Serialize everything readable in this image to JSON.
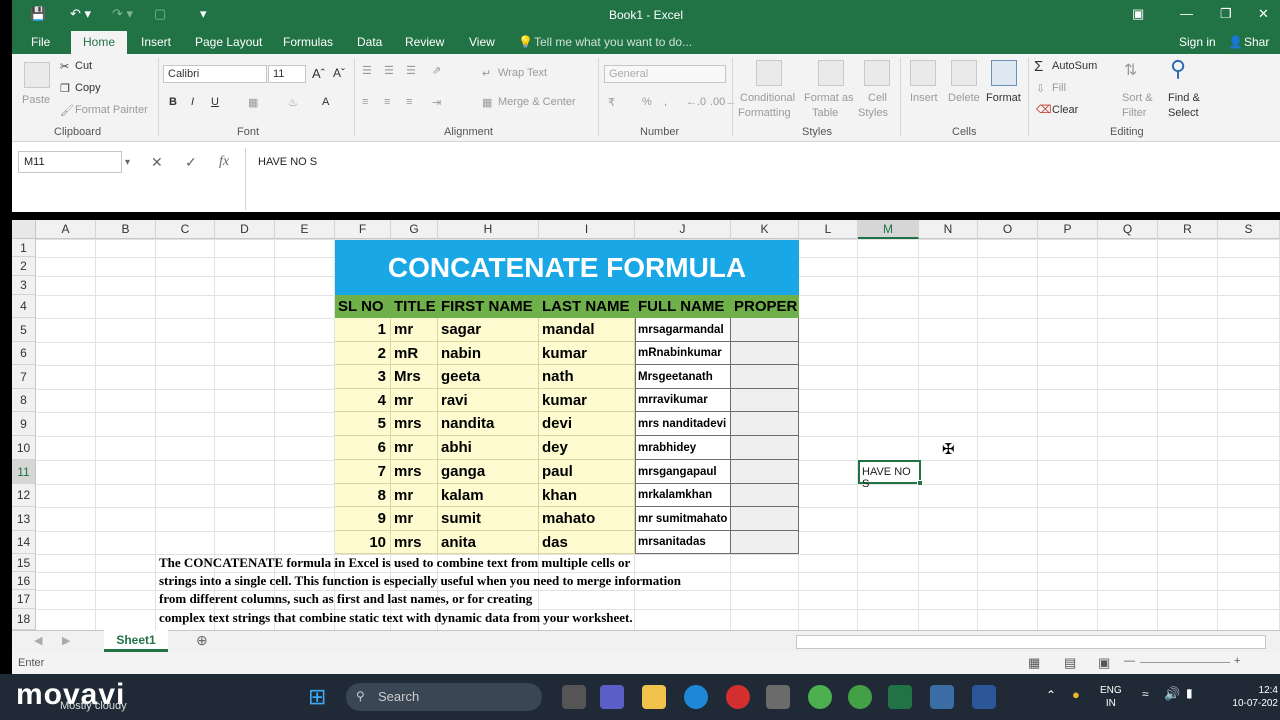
{
  "titlebar": {
    "title": "Book1 - Excel"
  },
  "menu": {
    "file": "File",
    "home": "Home",
    "insert": "Insert",
    "page_layout": "Page Layout",
    "formulas": "Formulas",
    "data": "Data",
    "review": "Review",
    "view": "View",
    "tell_me": "Tell me what you want to do...",
    "sign_in": "Sign in",
    "share": "Shar"
  },
  "ribbon": {
    "paste": "Paste",
    "cut": "Cut",
    "copy": "Copy",
    "format_painter": "Format Painter",
    "font_name": "Calibri",
    "font_size": "11",
    "bold": "B",
    "italic": "I",
    "underline": "U",
    "wrap_text": "Wrap Text",
    "merge_center": "Merge & Center",
    "number_format": "General",
    "percent": "%",
    "conditional_formatting_1": "Conditional",
    "conditional_formatting_2": "Formatting",
    "format_as_table_1": "Format as",
    "format_as_table_2": "Table",
    "cell_styles_1": "Cell",
    "cell_styles_2": "Styles",
    "insert": "Insert",
    "delete": "Delete",
    "format": "Format",
    "autosum": "AutoSum",
    "fill": "Fill",
    "clear": "Clear",
    "sort_filter_1": "Sort &",
    "sort_filter_2": "Filter",
    "find_select_1": "Find &",
    "find_select_2": "Select",
    "groups": {
      "clipboard": "Clipboard",
      "font": "Font",
      "alignment": "Alignment",
      "number": "Number",
      "styles": "Styles",
      "cells": "Cells",
      "editing": "Editing"
    }
  },
  "formula_bar": {
    "name_box": "M11",
    "value": "HAVE NO S"
  },
  "columns": [
    "A",
    "B",
    "C",
    "D",
    "E",
    "F",
    "G",
    "H",
    "I",
    "J",
    "K",
    "L",
    "M",
    "N",
    "O",
    "P",
    "Q",
    "R",
    "S"
  ],
  "rows": [
    "1",
    "2",
    "3",
    "4",
    "5",
    "6",
    "7",
    "8",
    "9",
    "10",
    "11",
    "12",
    "13",
    "14",
    "15",
    "16",
    "17",
    "18"
  ],
  "sheet": {
    "banner": "CONCATENATE FORMULA",
    "headers": [
      "SL NO",
      "TITLE",
      "FIRST NAME",
      "LAST NAME",
      "FULL NAME",
      "PROPER"
    ],
    "data": [
      [
        "1",
        "mr",
        "sagar",
        "mandal",
        "mrsagarmandal"
      ],
      [
        "2",
        "mR",
        "nabin",
        "kumar",
        "mRnabinkumar"
      ],
      [
        "3",
        "Mrs",
        "geeta",
        "nath",
        "Mrsgeetanath"
      ],
      [
        "4",
        "mr",
        "ravi",
        "kumar",
        "mrravikumar"
      ],
      [
        "5",
        "mrs",
        "nandita",
        "devi",
        "mrs nanditadevi"
      ],
      [
        "6",
        "mr",
        "abhi",
        "dey",
        "mrabhidey"
      ],
      [
        "7",
        "mrs",
        "ganga",
        "paul",
        "mrsgangapaul"
      ],
      [
        "8",
        "mr",
        "kalam",
        "khan",
        "mrkalamkhan"
      ],
      [
        "9",
        "mr",
        "sumit",
        "mahato",
        "mr sumitmahato"
      ],
      [
        "10",
        "mrs",
        "anita",
        "das",
        "mrsanitadas"
      ]
    ],
    "notes": [
      "The CONCATENATE formula in Excel is used to combine text from multiple cells or",
      "strings into a single cell. This function is especially useful when you need to merge information",
      "from different columns, such as first and last names, or for creating",
      "complex text strings that combine static text with dynamic data from your worksheet."
    ],
    "active_cell_value": "HAVE NO S"
  },
  "sheet_tab": "Sheet1",
  "status": "Enter",
  "taskbar": {
    "watermark": "movavi",
    "weather": "Mostly cloudy",
    "search": "Search",
    "lang_1": "ENG",
    "lang_2": "IN",
    "time": "12:4",
    "date": "10-07-202"
  },
  "colors": {
    "excel_green": "#217346",
    "banner_blue": "#1aa7e6",
    "header_green": "#6fb04a",
    "row_yellow": "#fdfbcf"
  }
}
